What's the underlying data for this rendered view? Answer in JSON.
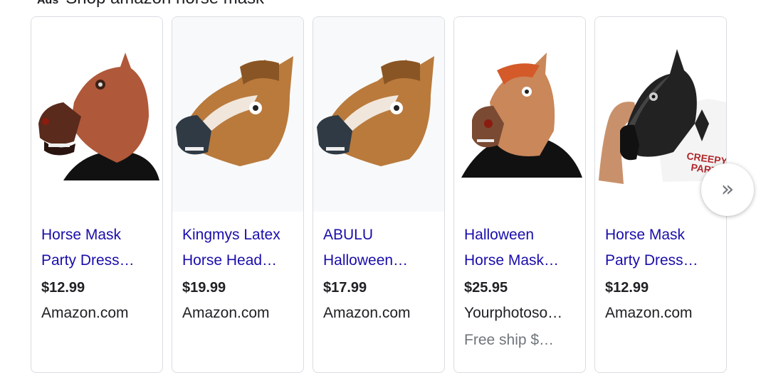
{
  "header": {
    "ads_label": "Ads",
    "title": "Shop amazon horse mask"
  },
  "products": [
    {
      "title_line1": "Horse Mask",
      "title_line2": "Party Dress…",
      "price": "$12.99",
      "store": "Amazon.com",
      "shipping": "",
      "image": "horse-mask-realistic-brown-icon"
    },
    {
      "title_line1": "Kingmys Latex",
      "title_line2": "Horse Head…",
      "price": "$19.99",
      "store": "Amazon.com",
      "shipping": "",
      "image": "horse-head-mask-icon"
    },
    {
      "title_line1": "ABULU",
      "title_line2": "Halloween…",
      "price": "$17.99",
      "store": "Amazon.com",
      "shipping": "",
      "image": "horse-head-mask-icon"
    },
    {
      "title_line1": "Halloween",
      "title_line2": "Horse Mask…",
      "price": "$25.95",
      "store": "Yourphotoso…",
      "shipping": "Free ship $…",
      "image": "horse-mask-tan-icon"
    },
    {
      "title_line1": "Horse Mask",
      "title_line2": "Party Dress…",
      "price": "$12.99",
      "store": "Amazon.com",
      "shipping": "",
      "image": "horse-mask-black-icon",
      "image_overlay_text": "CREEPY PARTY"
    }
  ],
  "next_button": {
    "icon": "double-chevron-right-icon",
    "glyph": "»"
  },
  "colors": {
    "link": "#1a0dab",
    "text": "#202124",
    "muted": "#70757a",
    "border": "#dadce0"
  }
}
